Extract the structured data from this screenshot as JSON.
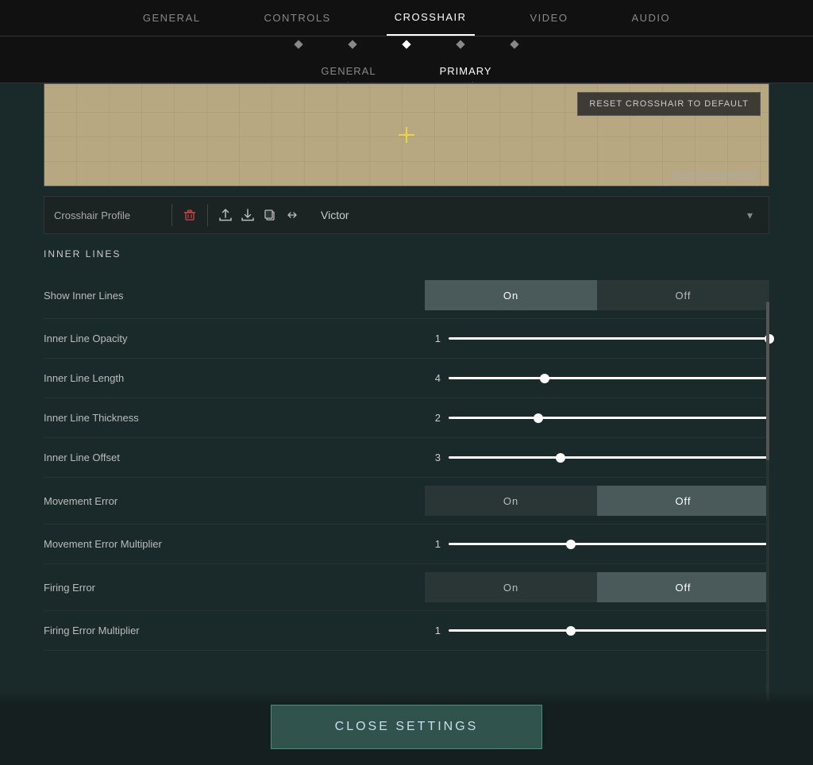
{
  "nav": {
    "items": [
      {
        "label": "GENERAL",
        "id": "general",
        "active": false
      },
      {
        "label": "CONTROLS",
        "id": "controls",
        "active": false
      },
      {
        "label": "CROSSHAIR",
        "id": "crosshair",
        "active": true
      },
      {
        "label": "VIDEO",
        "id": "video",
        "active": false
      },
      {
        "label": "AUDIO",
        "id": "audio",
        "active": false
      }
    ]
  },
  "subtabs": {
    "items": [
      {
        "label": "GENERAL",
        "active": false
      },
      {
        "label": "PRIMARY",
        "active": true
      }
    ]
  },
  "preview": {
    "reset_btn": "RESET CROSSHAIR TO DEFAULT",
    "elements_misaligned": "Elements misaligned?"
  },
  "profile": {
    "label": "Crosshair Profile",
    "selected": "Victor"
  },
  "inner_lines": {
    "section_title": "INNER LINES",
    "rows": [
      {
        "label": "Show Inner Lines",
        "type": "toggle",
        "value": "On",
        "options": [
          "On",
          "Off"
        ],
        "active": "On"
      },
      {
        "label": "Inner Line Opacity",
        "type": "slider",
        "value": "1",
        "percent": 100
      },
      {
        "label": "Inner Line Length",
        "type": "slider",
        "value": "4",
        "percent": 30
      },
      {
        "label": "Inner Line Thickness",
        "type": "slider",
        "value": "2",
        "percent": 28
      },
      {
        "label": "Inner Line Offset",
        "type": "slider",
        "value": "3",
        "percent": 35
      },
      {
        "label": "Movement Error",
        "type": "toggle",
        "value": "Off",
        "options": [
          "On",
          "Off"
        ],
        "active": "Off"
      },
      {
        "label": "Movement Error Multiplier",
        "type": "slider",
        "value": "1",
        "percent": 38
      },
      {
        "label": "Firing Error",
        "type": "toggle",
        "value": "Off",
        "options": [
          "On",
          "Off"
        ],
        "active": "Off"
      },
      {
        "label": "Firing Error Multiplier",
        "type": "slider",
        "value": "1",
        "percent": 38
      }
    ]
  },
  "close_btn": "CLOSE SETTINGS"
}
